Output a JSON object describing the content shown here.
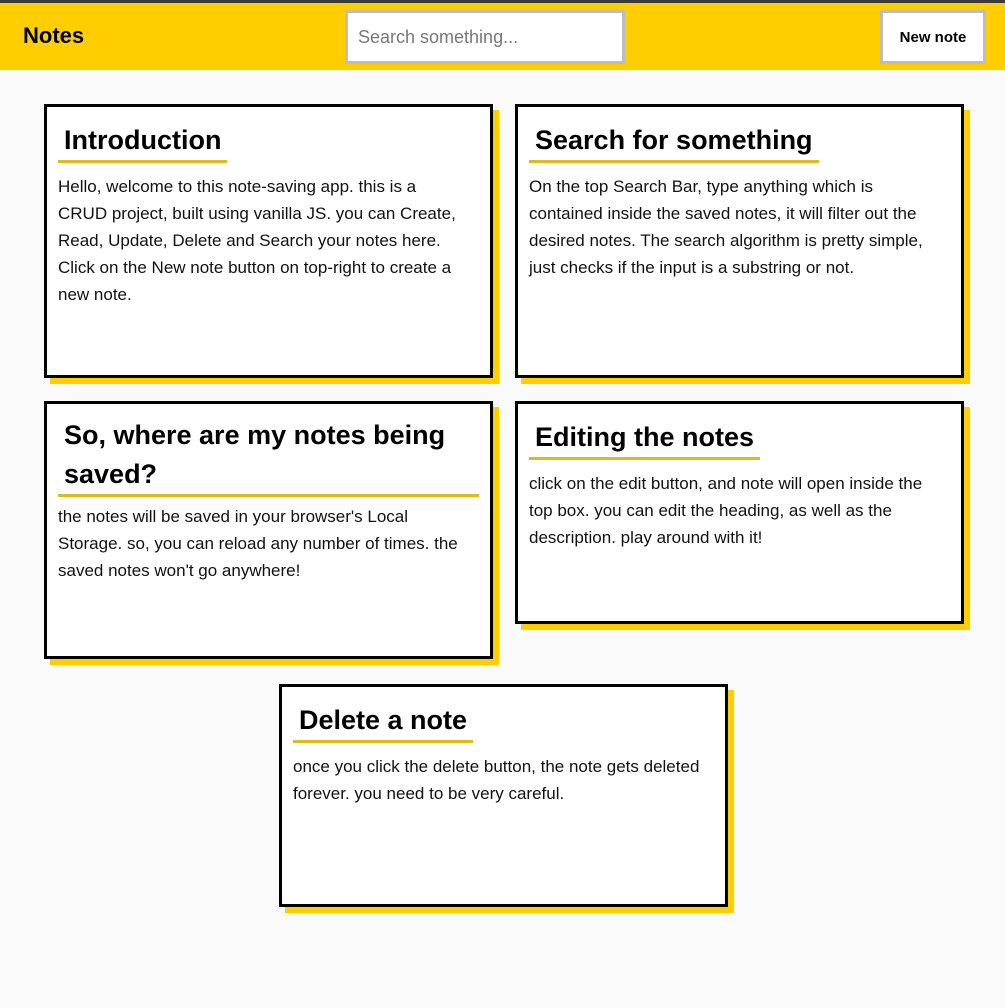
{
  "header": {
    "title": "Notes",
    "search_placeholder": "Search something...",
    "new_note_label": "New note"
  },
  "notes": [
    {
      "title": "Introduction",
      "body": "Hello, welcome to this note-saving app. this is a CRUD project, built using vanilla JS. you can Create, Read, Update, Delete and Search your notes here. Click on the New note button on top-right to create a new note."
    },
    {
      "title": "Search for something",
      "body": "On the top Search Bar, type anything which is contained inside the saved notes, it will filter out the desired notes. The search algorithm is pretty simple, just checks if the input is a substring or not."
    },
    {
      "title": "So, where are my notes being saved?",
      "body": "the notes will be saved in your browser's Local Storage. so, you can reload any number of times. the saved notes won't go anywhere!"
    },
    {
      "title": "Editing the notes",
      "body": "click on the edit button, and note will open inside the top box. you can edit the heading, as well as the description. play around with it!"
    },
    {
      "title": "Delete a note",
      "body": "once you click the delete button, the note gets deleted forever. you need to be very careful."
    }
  ]
}
